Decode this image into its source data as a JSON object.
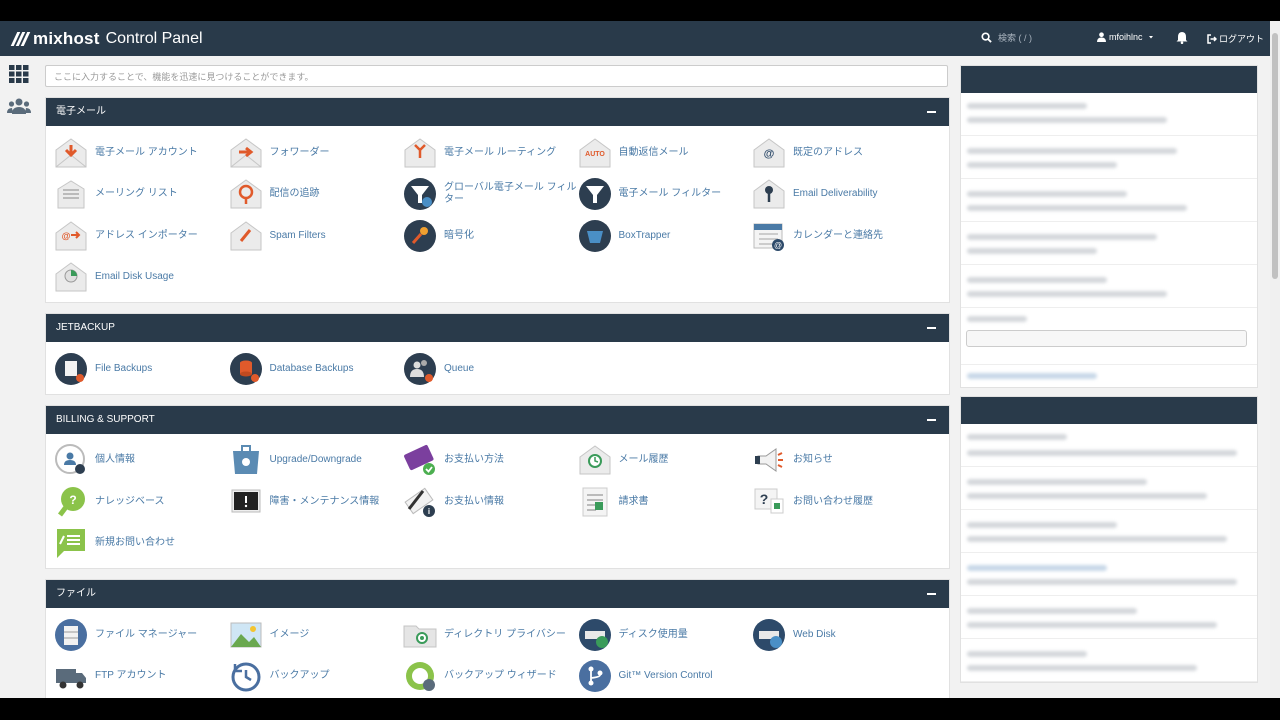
{
  "header": {
    "brand": "mixhost",
    "brand_sub": "Control Panel",
    "search_label": "検索 ( / )",
    "user": "mfoihlnc",
    "logout": "ログアウト"
  },
  "quick_search": {
    "placeholder": "ここに入力することで、機能を迅速に見つけることができます。"
  },
  "sections": {
    "email": {
      "title": "電子メール",
      "items": [
        "電子メール アカウント",
        "フォワーダー",
        "電子メール ルーティング",
        "自動返信メール",
        "既定のアドレス",
        "メーリング リスト",
        "配信の追跡",
        "グローバル電子メール フィルター",
        "電子メール フィルター",
        "Email Deliverability",
        "アドレス インポーター",
        "Spam Filters",
        "暗号化",
        "BoxTrapper",
        "カレンダーと連絡先",
        "Email Disk Usage"
      ]
    },
    "jetbackup": {
      "title": "JETBACKUP",
      "items": [
        "File Backups",
        "Database Backups",
        "Queue"
      ]
    },
    "billing": {
      "title": "BILLING & SUPPORT",
      "items": [
        "個人情報",
        "Upgrade/Downgrade",
        "お支払い方法",
        "メール履歴",
        "お知らせ",
        "ナレッジベース",
        "障害・メンテナンス情報",
        "お支払い情報",
        "請求書",
        "お問い合わせ履歴",
        "新規お問い合わせ"
      ]
    },
    "files": {
      "title": "ファイル",
      "items": [
        "ファイル マネージャー",
        "イメージ",
        "ディレクトリ プライバシー",
        "ディスク使用量",
        "Web Disk",
        "FTP アカウント",
        "バックアップ",
        "バックアップ ウィザード",
        "Git™ Version Control"
      ]
    }
  },
  "colors": {
    "header_bg": "#293a4a",
    "link": "#4a7aa6",
    "page_bg": "#f2f2f2"
  }
}
